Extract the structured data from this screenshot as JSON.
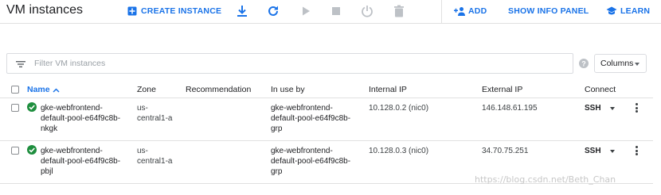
{
  "header": {
    "title": "VM instances",
    "create_instance_label": "CREATE INSTANCE",
    "add_label": "ADD",
    "show_info_panel_label": "SHOW INFO PANEL",
    "learn_label": "LEARN"
  },
  "filter": {
    "placeholder": "Filter VM instances"
  },
  "columns_button": {
    "label": "Columns"
  },
  "table": {
    "headers": {
      "name": "Name",
      "zone": "Zone",
      "recommendation": "Recommendation",
      "in_use_by": "In use by",
      "internal_ip": "Internal IP",
      "external_ip": "External IP",
      "connect": "Connect"
    },
    "rows": [
      {
        "name": "gke-webfrontend-default-pool-e64f9c8b-nkgk",
        "zone": "us-central1-a",
        "recommendation": "",
        "in_use_by": "gke-webfrontend-default-pool-e64f9c8b-grp",
        "internal_ip": "10.128.0.2 (nic0)",
        "external_ip": "146.148.61.195",
        "connect": "SSH"
      },
      {
        "name": "gke-webfrontend-default-pool-e64f9c8b-pbjl",
        "zone": "us-central1-a",
        "recommendation": "",
        "in_use_by": "gke-webfrontend-default-pool-e64f9c8b-grp",
        "internal_ip": "10.128.0.3 (nic0)",
        "external_ip": "34.70.75.251",
        "connect": "SSH"
      }
    ]
  },
  "watermark": "https://blog.csdn.net/Beth_Chan",
  "colors": {
    "accent": "#1a73e8",
    "status_ok": "#1e8e3e",
    "icon_disabled": "#bdc1c6"
  }
}
